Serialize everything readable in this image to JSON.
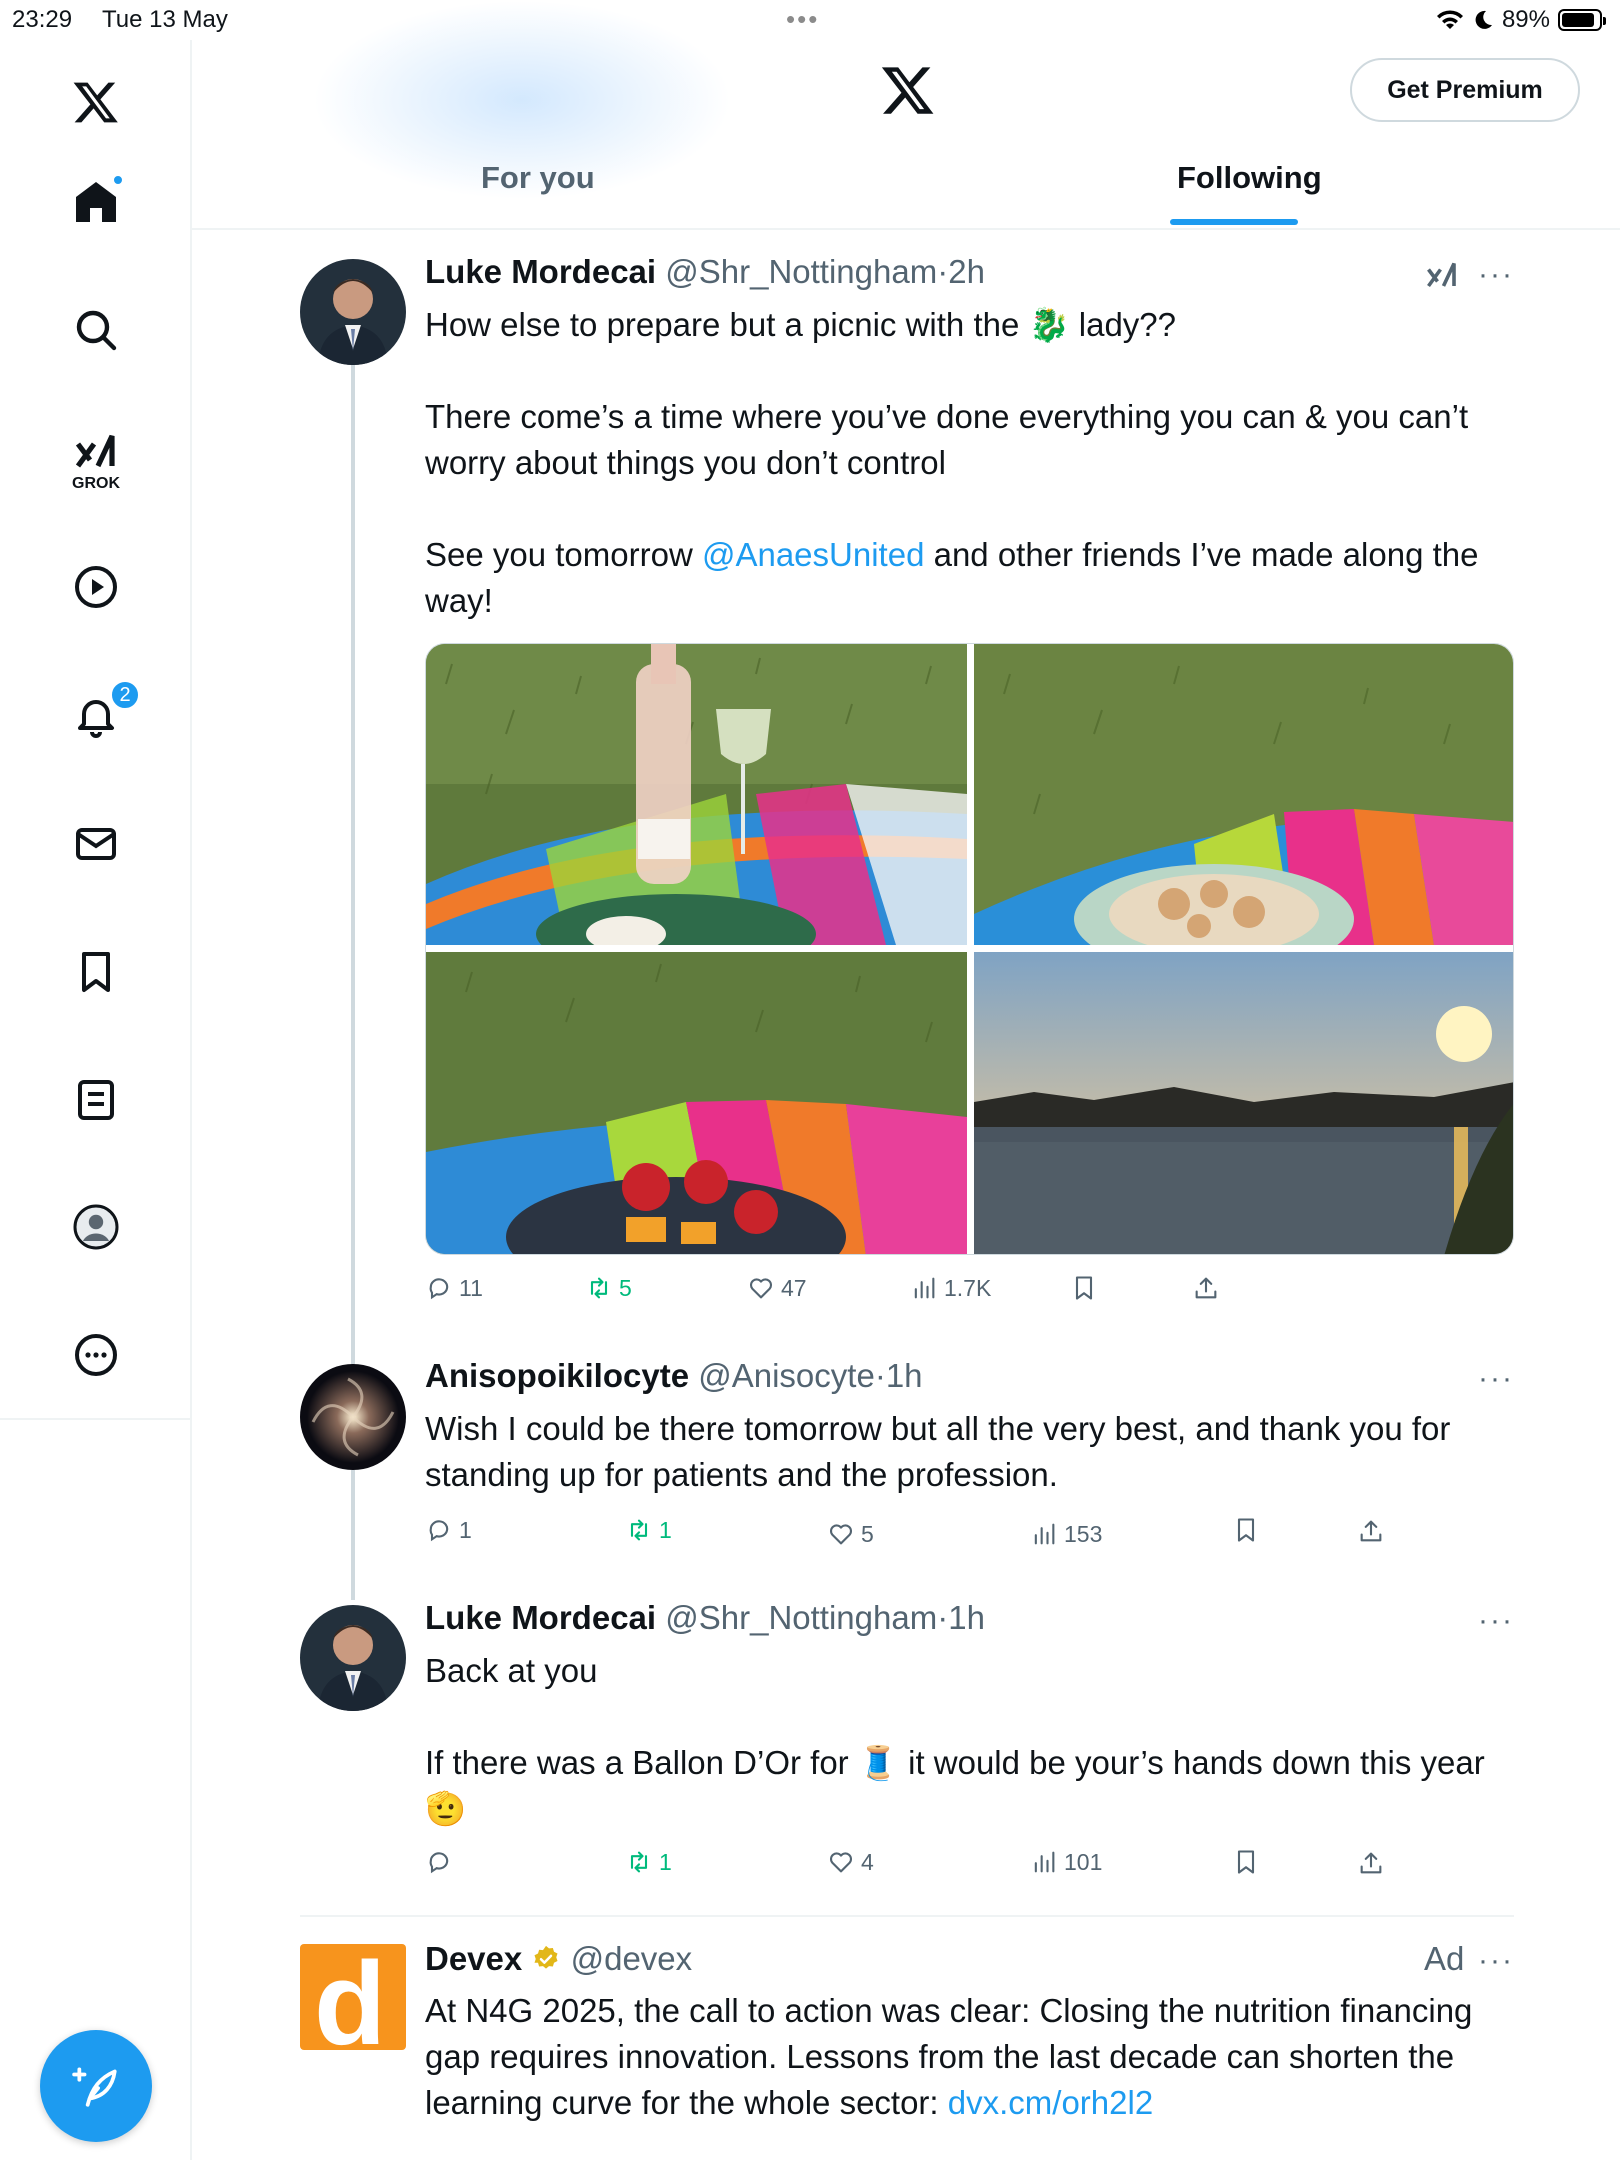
{
  "status_bar": {
    "time": "23:29",
    "date": "Tue 13 May",
    "battery": "89%",
    "battery_level": 0.89
  },
  "sidebar": {
    "grok_label": "GROK",
    "notifications_count": "2"
  },
  "header": {
    "premium_button": "Get Premium",
    "tabs": [
      {
        "label": "For you",
        "active": false
      },
      {
        "label": "Following",
        "active": true
      }
    ]
  },
  "posts": [
    {
      "name": "Luke Mordecai",
      "handle": "@Shr_Nottingham",
      "sep": "·",
      "time": "2h",
      "body_line1_pre": "How else to prepare but a picnic with the ",
      "body_line1_emoji": "🐉",
      "body_line1_post": " lady??",
      "body_para2": "There come’s a time where you’ve done everything you can & you can’t worry about things you don’t control",
      "body_para3_pre": "See you tomorrow ",
      "body_para3_link": "@AnaesUnited",
      "body_para3_post": " and other friends I’ve made along the way!",
      "replies": "11",
      "reposts": "5",
      "likes": "47",
      "views": "1.7K"
    },
    {
      "name": "Anisopoikilocyte",
      "handle": "@Anisocyte",
      "sep": "·",
      "time": "1h",
      "body": "Wish I could be there tomorrow but all the very best, and thank you for standing up for patients and the profession.",
      "replies": "1",
      "reposts": "1",
      "likes": "5",
      "views": "153"
    },
    {
      "name": "Luke Mordecai",
      "handle": "@Shr_Nottingham",
      "sep": "·",
      "time": "1h",
      "body_line1": "Back at you",
      "body_para2_pre": "If there was a Ballon D’Or for ",
      "body_para2_emoji": "🧵",
      "body_para2_post": " it would be your’s hands down this year ",
      "body_para2_emoji2": "🫡",
      "replies": "",
      "reposts": "1",
      "likes": "4",
      "views": "101"
    },
    {
      "name": "Devex",
      "handle": "@devex",
      "ad": "Ad",
      "avatar_letter": "d",
      "body_pre": "At N4G 2025, the call to action was clear: Closing the nutrition financing gap requires innovation. Lessons from the last decade can shorten the learning curve for the whole sector: ",
      "body_link": "dvx.cm/orh2l2"
    }
  ],
  "colors": {
    "accent": "#1d9bf0",
    "repost_green": "#00ba7c",
    "muted": "#536471",
    "devex_orange": "#f7941d"
  }
}
